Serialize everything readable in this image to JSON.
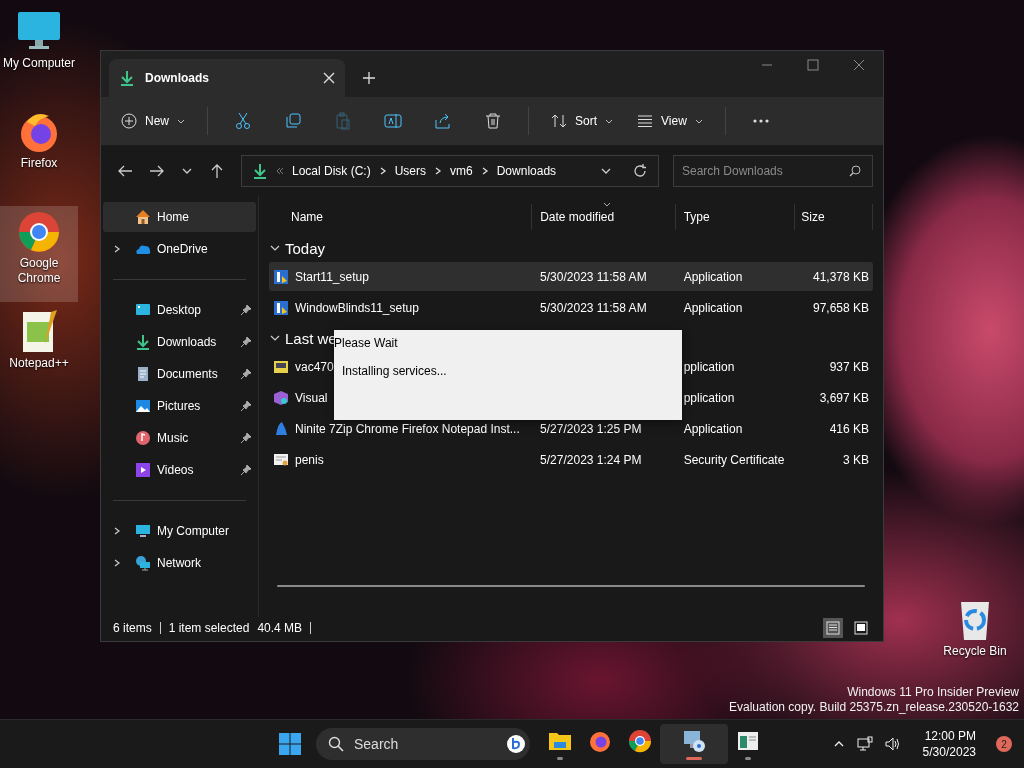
{
  "desktop_icons": [
    {
      "kind": "computer",
      "label": "My Computer",
      "selected": false
    },
    {
      "kind": "firefox",
      "label": "Firefox",
      "selected": false
    },
    {
      "kind": "chrome",
      "label": "Google Chrome",
      "selected": true
    },
    {
      "kind": "notepad",
      "label": "Notepad++",
      "selected": false
    }
  ],
  "recycle_bin": {
    "label": "Recycle Bin"
  },
  "window": {
    "tab_title": "Downloads",
    "toolbar": {
      "new": "New",
      "actions": [
        {
          "kind": "cut",
          "disabled": false
        },
        {
          "kind": "copy",
          "disabled": false
        },
        {
          "kind": "paste",
          "disabled": true
        },
        {
          "kind": "rename",
          "disabled": false
        },
        {
          "kind": "share",
          "disabled": false
        },
        {
          "kind": "delete",
          "disabled": false
        }
      ],
      "sort": "Sort",
      "view": "View"
    },
    "address": {
      "crumbs": [
        "Local Disk (C:)",
        "Users",
        "vm6",
        "Downloads"
      ]
    },
    "search": {
      "placeholder": "Search Downloads"
    },
    "sidebar": {
      "sections": [
        {
          "items": [
            {
              "kind": "home",
              "label": "Home",
              "selected": true,
              "expandable": false,
              "pinned": false
            },
            {
              "kind": "onedrive",
              "label": "OneDrive",
              "selected": false,
              "expandable": true,
              "pinned": false
            }
          ]
        },
        {
          "items": [
            {
              "kind": "desktop",
              "label": "Desktop",
              "selected": false,
              "expandable": false,
              "pinned": true
            },
            {
              "kind": "downloads",
              "label": "Downloads",
              "selected": false,
              "expandable": false,
              "pinned": true
            },
            {
              "kind": "documents",
              "label": "Documents",
              "selected": false,
              "expandable": false,
              "pinned": true
            },
            {
              "kind": "pictures",
              "label": "Pictures",
              "selected": false,
              "expandable": false,
              "pinned": true
            },
            {
              "kind": "music",
              "label": "Music",
              "selected": false,
              "expandable": false,
              "pinned": true
            },
            {
              "kind": "videos",
              "label": "Videos",
              "selected": false,
              "expandable": false,
              "pinned": true
            }
          ]
        },
        {
          "items": [
            {
              "kind": "computer",
              "label": "My Computer",
              "selected": false,
              "expandable": true,
              "pinned": false
            },
            {
              "kind": "network",
              "label": "Network",
              "selected": false,
              "expandable": true,
              "pinned": false
            }
          ]
        }
      ]
    },
    "columns": [
      {
        "label": "Name",
        "sorted": false
      },
      {
        "label": "Date modified",
        "sorted": true
      },
      {
        "label": "Type",
        "sorted": false
      },
      {
        "label": "Size",
        "sorted": false
      }
    ],
    "groups": [
      {
        "label": "Today",
        "expanded": true,
        "rows": [
          {
            "kind": "installer",
            "name": "Start11_setup",
            "date": "5/30/2023 11:58 AM",
            "type": "Application",
            "size": "41,378 KB",
            "selected": true
          },
          {
            "kind": "installer",
            "name": "WindowBlinds11_setup",
            "date": "5/30/2023 11:58 AM",
            "type": "Application",
            "size": "97,658 KB",
            "selected": false
          }
        ]
      },
      {
        "label": "Last we",
        "expanded": true,
        "rows": [
          {
            "kind": "app",
            "name": "vac470",
            "type": "pplication",
            "size": "937 KB",
            "selected": false
          },
          {
            "kind": "visual",
            "name": "Visual",
            "type": "pplication",
            "size": "3,697 KB",
            "selected": false
          },
          {
            "kind": "ninite",
            "name": "Ninite 7Zip Chrome Firefox Notepad Inst...",
            "date": "5/27/2023 1:25 PM",
            "type": "Application",
            "size": "416 KB",
            "selected": false
          },
          {
            "kind": "certificate",
            "name": "penis",
            "date": "5/27/2023 1:24 PM",
            "type": "Security Certificate",
            "size": "3 KB",
            "selected": false
          }
        ]
      }
    ],
    "status": {
      "count": "6 items",
      "selection": "1 item selected",
      "size": "40.4 MB"
    },
    "view_modes": [
      {
        "kind": "details",
        "selected": true
      },
      {
        "kind": "tiles",
        "selected": false
      }
    ]
  },
  "dialog": {
    "title": "Please Wait",
    "message": "Installing services..."
  },
  "os_notice": [
    "Windows 11 Pro Insider Preview",
    "Evaluation copy. Build 25375.zn_release.230520-1632"
  ],
  "taskbar": {
    "search": "Search",
    "apps": [
      {
        "kind": "explorer",
        "running": true,
        "active": false
      },
      {
        "kind": "firefox",
        "running": false,
        "active": false
      },
      {
        "kind": "chrome",
        "running": false,
        "active": false
      },
      {
        "kind": "setup",
        "running": true,
        "active": true
      },
      {
        "kind": "window",
        "running": true,
        "active": false
      }
    ],
    "time": "12:00 PM",
    "date": "5/30/2023",
    "notifications": "2"
  }
}
